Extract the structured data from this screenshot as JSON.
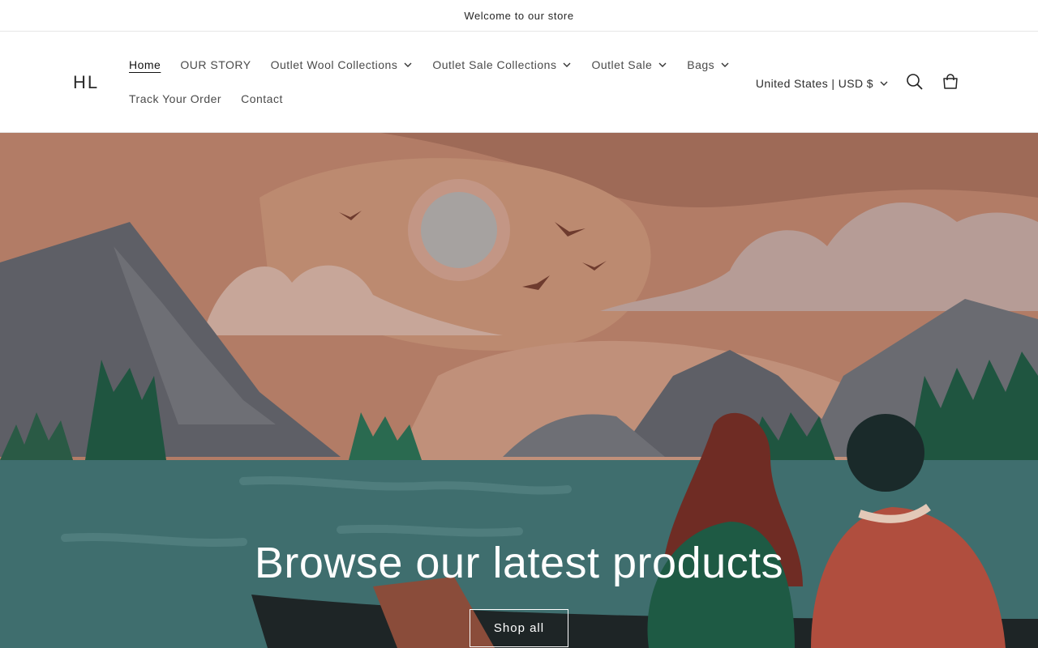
{
  "announcement": {
    "text": "Welcome to our store"
  },
  "header": {
    "logo": "HL",
    "nav": [
      {
        "label": "Home",
        "active": true,
        "dropdown": false
      },
      {
        "label": "OUR STORY",
        "dropdown": false
      },
      {
        "label": "Outlet Wool Collections",
        "dropdown": true
      },
      {
        "label": "Outlet Sale Collections",
        "dropdown": true
      },
      {
        "label": "Outlet Sale",
        "dropdown": true
      },
      {
        "label": "Bags",
        "dropdown": true
      },
      {
        "label": "Track Your Order",
        "dropdown": false
      },
      {
        "label": "Contact",
        "dropdown": false
      }
    ],
    "locale": "United States | USD $",
    "icons": {
      "search": "search-icon",
      "cart": "cart-icon",
      "locale_chevron": "chevron-down-icon"
    }
  },
  "hero": {
    "title": "Browse our latest products",
    "button": "Shop all"
  },
  "colors": {
    "sky": "#B07A64",
    "water": "#3F6E6E",
    "text_on_hero": "#FFFFFF"
  }
}
